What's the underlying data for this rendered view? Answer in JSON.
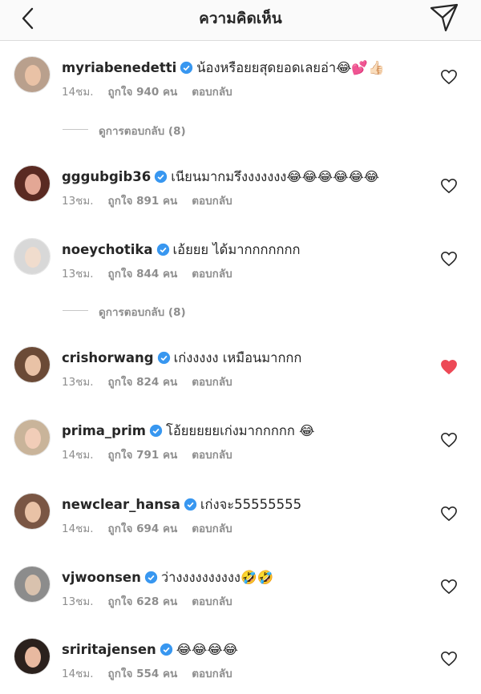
{
  "header": {
    "title": "ความคิดเห็น"
  },
  "view_replies_label": "ดูการตอบกลับ (8)",
  "comments": [
    {
      "username": "myriabenedetti",
      "text": "น้องหรือยยสุดยอดเลยอ่า😂💕👍🏻",
      "time": "14ชม.",
      "likes": "ถูกใจ 940 คน",
      "reply": "ตอบกลับ",
      "liked": false
    },
    {
      "username": "gggubgib36",
      "text": "เนียนมากมรึงงงงงงง😂😂😂😂😂😂",
      "time": "13ชม.",
      "likes": "ถูกใจ 891 คน",
      "reply": "ตอบกลับ",
      "liked": false
    },
    {
      "username": "noeychotika",
      "text": "เอ้ยยย ได้มากกกกกกก",
      "time": "13ชม.",
      "likes": "ถูกใจ 844 คน",
      "reply": "ตอบกลับ",
      "liked": false
    },
    {
      "username": "crishorwang",
      "text": "เก่งงงงง เหมือนมากกก",
      "time": "13ชม.",
      "likes": "ถูกใจ 824 คน",
      "reply": "ตอบกลับ",
      "liked": true
    },
    {
      "username": "prima_prim",
      "text": "โอ้ยยยยยเก่งมากกกกก 😂",
      "time": "14ชม.",
      "likes": "ถูกใจ 791 คน",
      "reply": "ตอบกลับ",
      "liked": false
    },
    {
      "username": "newclear_hansa",
      "text": "เก่งจะ55555555",
      "time": "14ชม.",
      "likes": "ถูกใจ 694 คน",
      "reply": "ตอบกลับ",
      "liked": false
    },
    {
      "username": "vjwoonsen",
      "text": "ว่างงงงงงงงงง🤣🤣",
      "time": "13ชม.",
      "likes": "ถูกใจ 628 คน",
      "reply": "ตอบกลับ",
      "liked": false
    },
    {
      "username": "sriritajensen",
      "text": "😂😂😂😂",
      "time": "14ชม.",
      "likes": "ถูกใจ 554 คน",
      "reply": "ตอบกลับ",
      "liked": false
    }
  ],
  "colors": {
    "heart_liked": "#ed4956",
    "verified": "#3897f0",
    "muted": "#8e8e8e"
  }
}
